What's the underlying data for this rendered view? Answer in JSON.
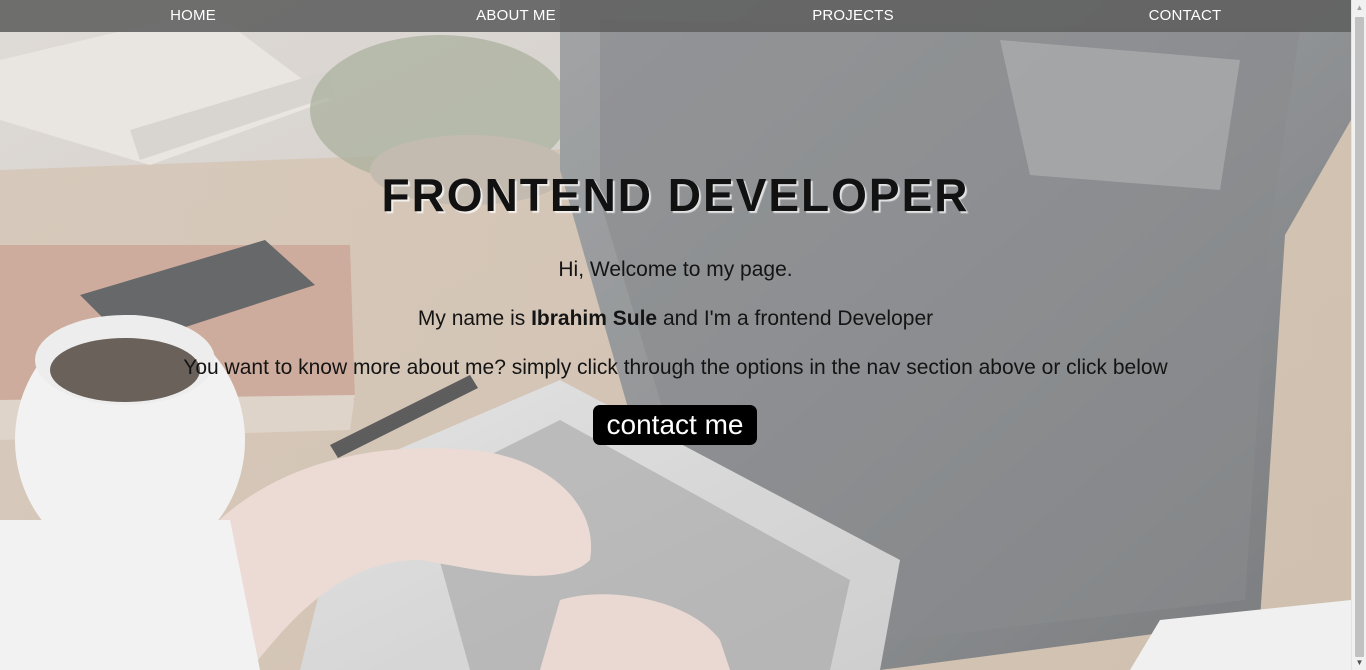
{
  "nav": {
    "items": [
      {
        "label": "HOME"
      },
      {
        "label": "ABOUT ME"
      },
      {
        "label": "PROJECTS"
      },
      {
        "label": "CONTACT"
      }
    ]
  },
  "hero": {
    "title": "FRONTEND DEVELOPER",
    "welcome": "Hi, Welcome to my page.",
    "intro_before": "My name is ",
    "name": "Ibrahim Sule",
    "intro_after": " and I'm a frontend Developer",
    "prompt": "You want to know more about me? simply click through the options in the nav section above or click below",
    "cta_label": "contact me"
  },
  "scrollbar": {
    "up_icon": "triangle-up",
    "down_icon": "triangle-down"
  },
  "colors": {
    "nav_bg": "#5f5f5f",
    "nav_text": "#ffffff",
    "cta_bg": "#000000",
    "cta_text": "#ffffff",
    "heading_text": "#111111"
  }
}
